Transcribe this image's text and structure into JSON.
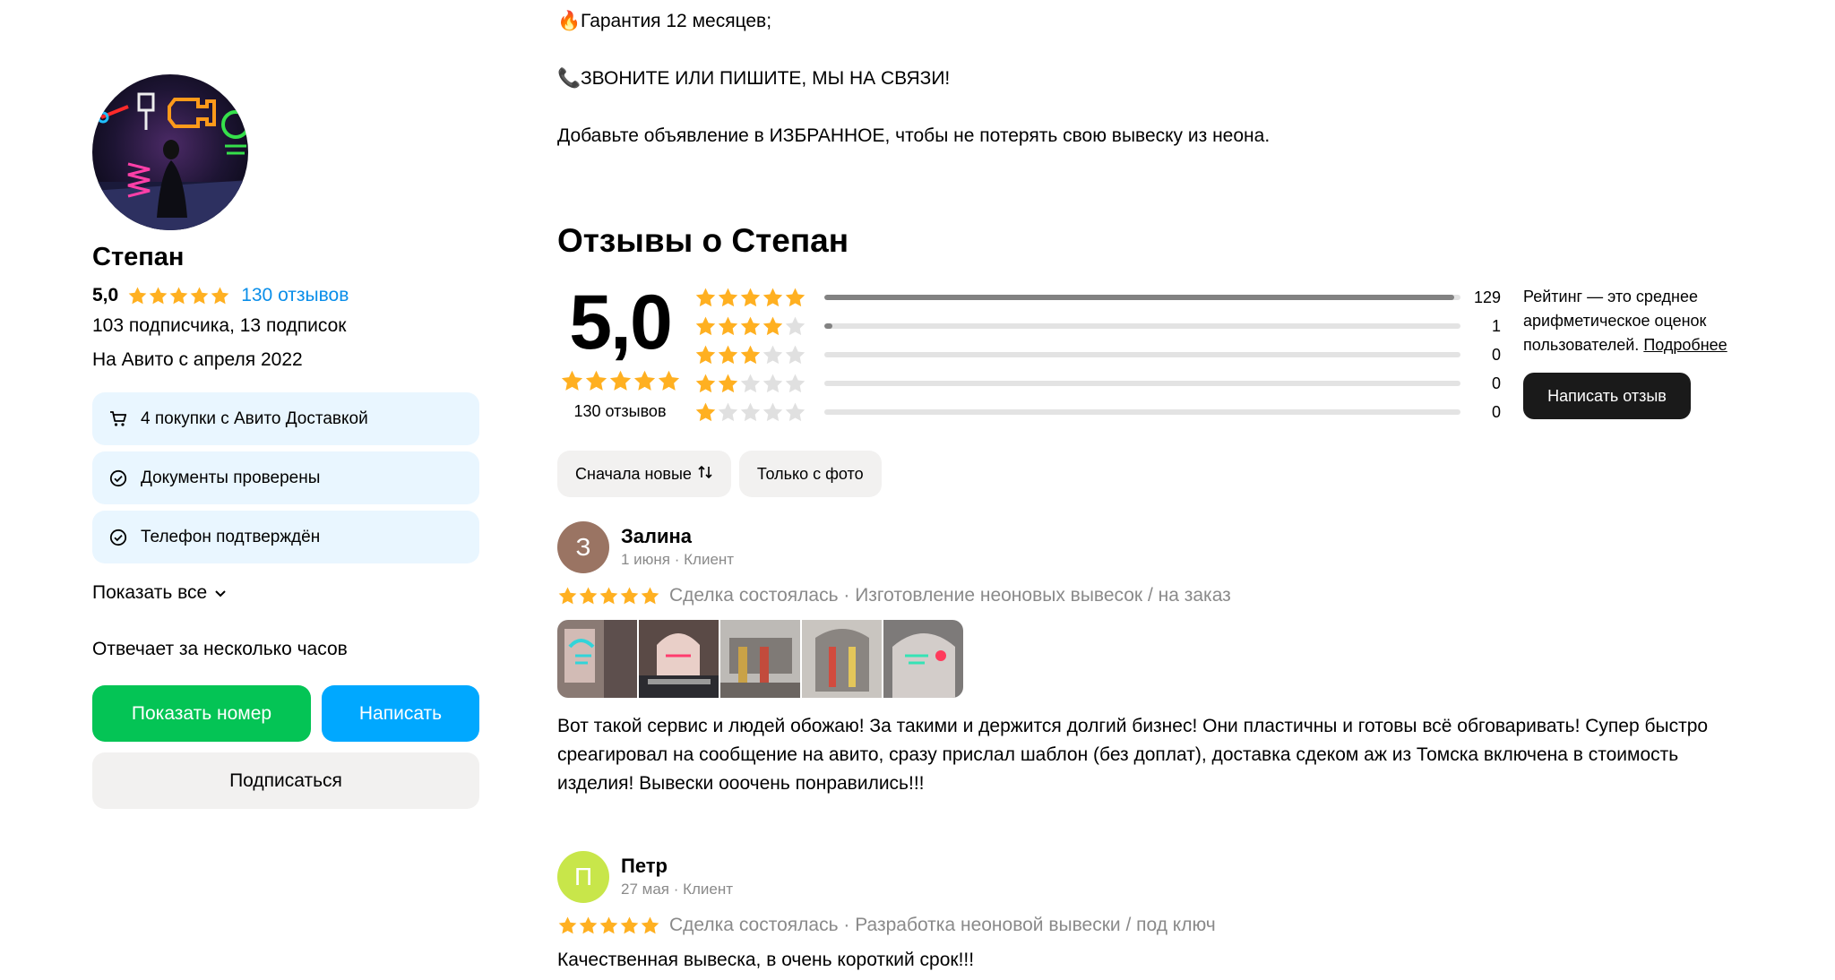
{
  "seller": {
    "name": "Степан",
    "rating": "5,0",
    "reviews_link": "130 отзывов",
    "subscribers": "103 подписчика, 13 подписок",
    "since": "На Авито с апреля 2022",
    "badges": [
      {
        "icon": "cart-icon",
        "label": "4 покупки с Авито Доставкой"
      },
      {
        "icon": "check-circle-icon",
        "label": "Документы проверены"
      },
      {
        "icon": "check-circle-icon",
        "label": "Телефон подтверждён"
      }
    ],
    "show_all": "Показать все",
    "response_time": "Отвечает за несколько часов",
    "buttons": {
      "phone": "Показать номер",
      "write": "Написать",
      "subscribe": "Подписаться"
    }
  },
  "description": {
    "lines": [
      {
        "emoji": "🔥",
        "text": "Гарантия 12 месяцев;"
      },
      {
        "emoji": "📞",
        "text": "ЗВОНИТЕ ИЛИ ПИШИТЕ, МЫ НА СВЯЗИ!"
      },
      {
        "emoji": "",
        "text": "Добавьте объявление в ИЗБРАННОЕ, чтобы не потерять свою вывеску из неона."
      }
    ]
  },
  "reviews": {
    "title": "Отзывы о Степан",
    "rating": "5,0",
    "count": "130 отзывов",
    "distribution": [
      {
        "stars": 5,
        "count": "129",
        "fraction": 0.99
      },
      {
        "stars": 4,
        "count": "1",
        "fraction": 0.008
      },
      {
        "stars": 3,
        "count": "0",
        "fraction": 0
      },
      {
        "stars": 2,
        "count": "0",
        "fraction": 0
      },
      {
        "stars": 1,
        "count": "0",
        "fraction": 0
      }
    ],
    "note": "Рейтинг — это среднее арифметическое оценок пользователей.",
    "note_link": "Подробнее",
    "write_review": "Написать отзыв",
    "filters": {
      "sort": "Сначала новые",
      "photo_only": "Только с фото"
    },
    "items": [
      {
        "initial": "З",
        "avatar_color": "#9a7463",
        "name": "Залина",
        "meta": "1 июня · Клиент",
        "stars": 5,
        "deal": "Сделка состоялась · Изготовление неоновых вывесок / на заказ",
        "photos": 5,
        "text": "Вот такой сервис и людей обожаю! За такими и держится долгий бизнес! Они пластичны и готовы всё обговаривать! Супер быстро среагировал на сообщение на авито, сразу прислал шаблон (без доплат), доставка сдеком аж из Томска включена в стоимость изделия! Вывески ооочень понравились!!!"
      },
      {
        "initial": "П",
        "avatar_color": "#c8e64a",
        "name": "Петр",
        "meta": "27 мая · Клиент",
        "stars": 5,
        "deal": "Сделка состоялась · Разработка неоновой вывески / под ключ",
        "photos": 0,
        "text": "Качественная вывеска, в очень короткий срок!!!"
      }
    ]
  },
  "colors": {
    "star": "#ffb021",
    "star_empty": "#e0e0e0",
    "link": "#0a8ee9",
    "green": "#04c455",
    "blue": "#00a8ff"
  }
}
